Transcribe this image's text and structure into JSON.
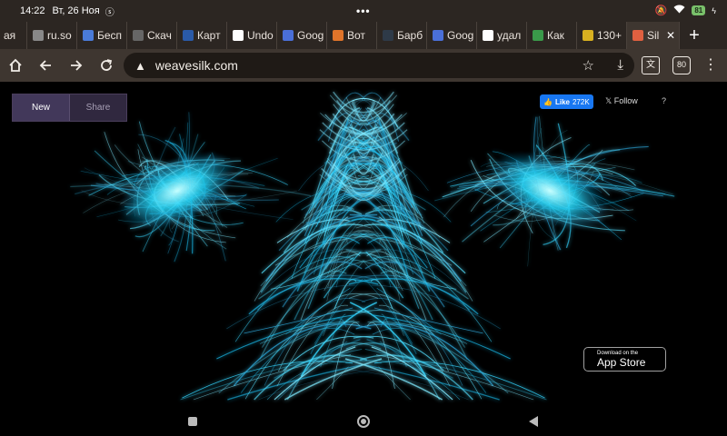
{
  "status_bar": {
    "time": "14:22",
    "date": "Вт, 26 Ноя",
    "battery": "81"
  },
  "tabs": [
    {
      "label": "ая",
      "favicon": "generic",
      "color": "#777777"
    },
    {
      "label": "ru.so",
      "favicon": "globe-icon",
      "color": "#888888"
    },
    {
      "label": "Бесп",
      "favicon": "back-arrow-icon",
      "color": "#4a7bd8"
    },
    {
      "label": "Скач",
      "favicon": "chrome-icon",
      "color": "#666666"
    },
    {
      "label": "Карт",
      "favicon": "card-icon",
      "color": "#2a5aa8"
    },
    {
      "label": "Undo",
      "favicon": "wikipedia-icon",
      "color": "#ffffff"
    },
    {
      "label": "Goog",
      "favicon": "docs-icon",
      "color": "#4a6fd8"
    },
    {
      "label": "Вот",
      "favicon": "pizza-icon",
      "color": "#e0742a"
    },
    {
      "label": "Барб",
      "favicon": "k-icon",
      "color": "#2e3a48"
    },
    {
      "label": "Goog",
      "favicon": "docs-icon",
      "color": "#4a6fd8"
    },
    {
      "label": "удал",
      "favicon": "google-icon",
      "color": "#ffffff"
    },
    {
      "label": "Как",
      "favicon": "sheet-icon",
      "color": "#3a9a4a"
    },
    {
      "label": "130+",
      "favicon": "clock-icon",
      "color": "#d8b020"
    },
    {
      "label": "Sil",
      "favicon": "silk-icon",
      "color": "#e06040",
      "active": true,
      "close": "✕"
    }
  ],
  "new_tab_label": "+",
  "toolbar": {
    "url": "weavesilk.com",
    "tab_count": "80"
  },
  "page": {
    "new_button": "New",
    "share_button": "Share",
    "fb_like": "Like",
    "fb_count": "272K",
    "follow": "Follow",
    "help": "?",
    "appstore_small": "Download on the",
    "appstore_big": "App Store"
  }
}
